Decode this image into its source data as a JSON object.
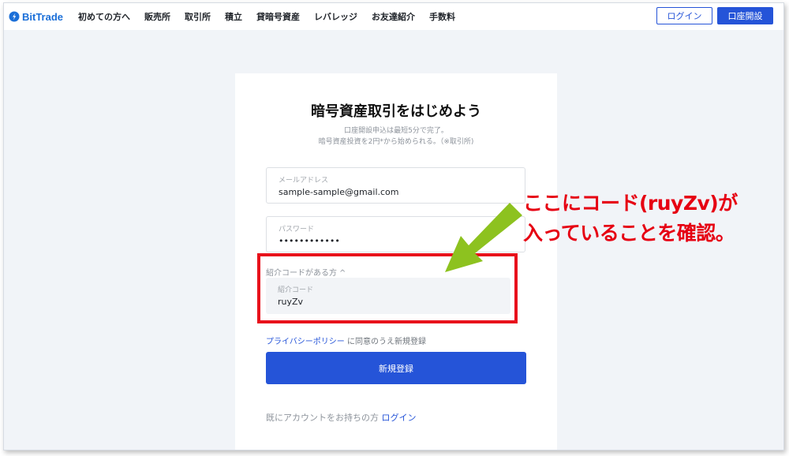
{
  "nav": {
    "logo_text": "BitTrade",
    "items": [
      "初めての方へ",
      "販売所",
      "取引所",
      "積立",
      "貸暗号資産",
      "レバレッジ",
      "お友達紹介",
      "手数料"
    ],
    "login_label": "ログイン",
    "open_account_label": "口座開設"
  },
  "signup": {
    "title": "暗号資産取引をはじめよう",
    "subtitle_line1": "口座開設申込は最短5分で完了。",
    "subtitle_line2": "暗号資産投資を2円*から始められる。（※取引所)",
    "email_label": "メールアドレス",
    "email_value": "sample-sample@gmail.com",
    "password_label": "パスワード",
    "password_value": "••••••••••••",
    "referral_toggle": "紹介コードがある方",
    "referral_label": "紹介コード",
    "referral_value": "ruyZv",
    "privacy_link": "プライバシーポリシー",
    "privacy_suffix": " に同意のうえ新規登録",
    "register_label": "新規登録",
    "existing_prefix": "既にアカウントをお持ちの方 ",
    "existing_login": "ログイン"
  },
  "annotation": {
    "line1": "ここにコード(ruyZv)が",
    "line2": "入っていることを確認。"
  },
  "colors": {
    "accent": "#2554d8",
    "highlight": "#e8101b",
    "annotation_text": "#e60012",
    "arrow": "#8dc21f"
  }
}
